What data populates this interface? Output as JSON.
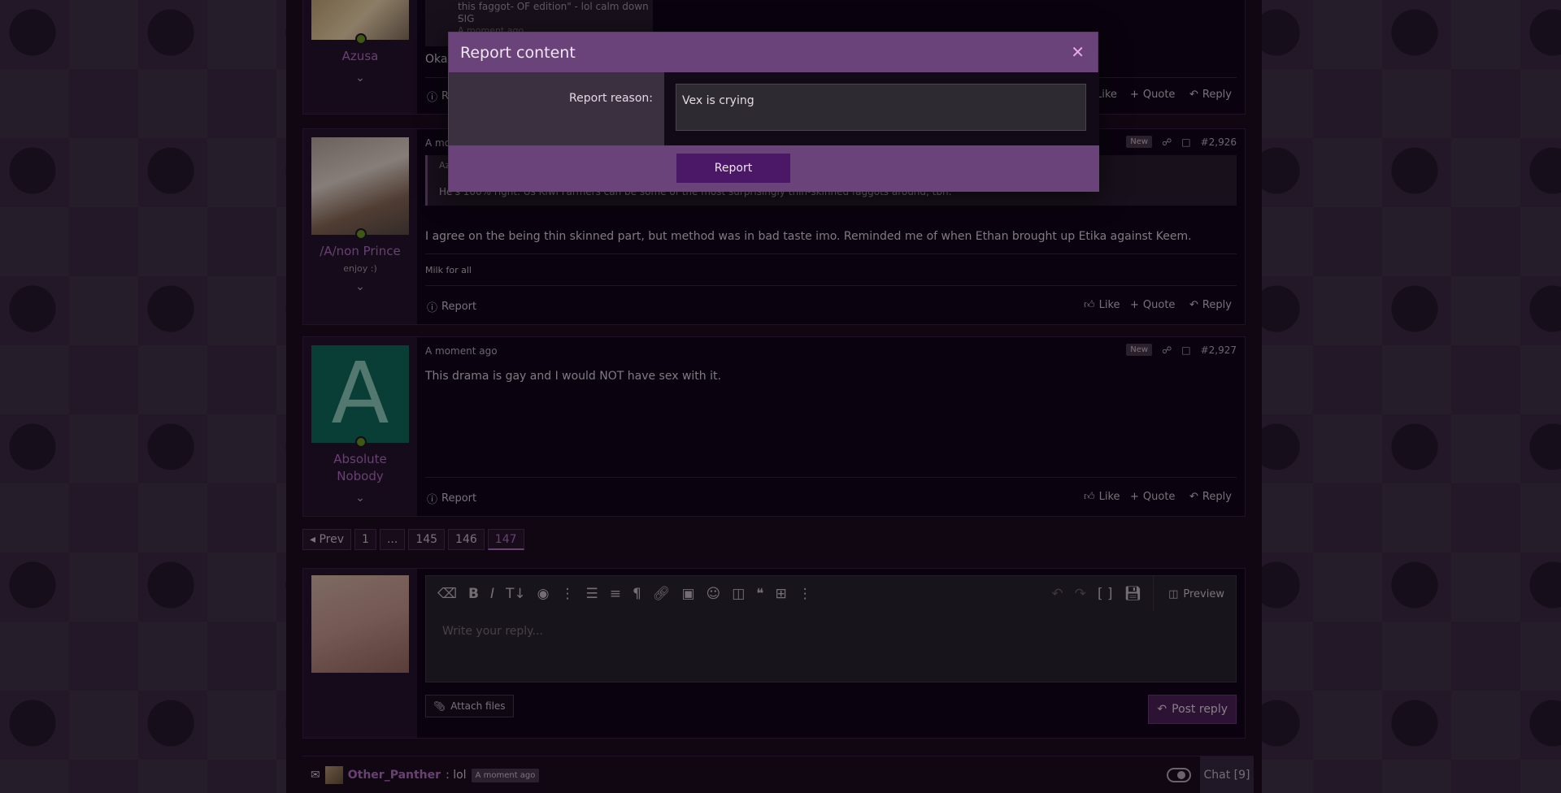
{
  "posts": [
    {
      "user": {
        "name": "Azusa",
        "title": ""
      },
      "quote_fragment_1": "this faggot- OF edition\" - lol calm down -",
      "quote_fragment_2": "SIG",
      "quote_fragment_3": "A moment ago",
      "message": "Okay",
      "actions": {
        "report_partial": "R",
        "like": "Like",
        "quote": "Quote",
        "reply": "Reply"
      }
    },
    {
      "user": {
        "name": "/A/non Prince",
        "title": "enjoy :)"
      },
      "time": "A mo",
      "new_badge": "New",
      "post_number": "#2,926",
      "quote_head": "Az",
      "quote_text": "He's 100% right. Us Kiwi Farmers can be some of the most surprisingly thin-skinned faggots around, tbh.",
      "message": "I agree on the being thin skinned part, but method was in bad taste imo. Reminded me of when Ethan brought up Etika against Keem.",
      "signature": "Milk for all",
      "actions": {
        "report": "Report",
        "like": "Like",
        "quote": "Quote",
        "reply": "Reply"
      }
    },
    {
      "user": {
        "name_line1": "Absolute",
        "name_line2": "Nobody",
        "avatar_letter": "A"
      },
      "time": "A moment ago",
      "new_badge": "New",
      "post_number": "#2,927",
      "message": "This drama is gay and I would NOT have sex with it.",
      "actions": {
        "report": "Report",
        "like": "Like",
        "quote": "Quote",
        "reply": "Reply"
      }
    }
  ],
  "pagination": {
    "prev": "Prev",
    "first": "1",
    "ellipsis": "...",
    "p145": "145",
    "p146": "146",
    "current": "147"
  },
  "reply": {
    "placeholder": "Write your reply...",
    "preview": "Preview",
    "attach": "Attach files",
    "post_reply": "Post reply"
  },
  "chat": {
    "user": "Other_Panther",
    "message": ": lol",
    "time": "A moment ago",
    "button": "Chat [9]"
  },
  "modal": {
    "title": "Report content",
    "label": "Report reason:",
    "reason_value": "Vex is crying",
    "submit": "Report"
  }
}
